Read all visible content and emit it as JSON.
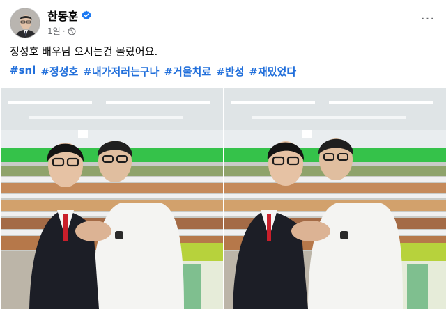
{
  "post": {
    "author": "한동훈",
    "time": "1일",
    "meta_separator": "·",
    "caption": "정성호 배우님 오시는건 몰랐어요.",
    "hashtags": [
      "#snl",
      "#정성호",
      "#내가저러는구나",
      "#거울치료",
      "#반성",
      "#재밌었다"
    ],
    "more_icon_text": "···"
  },
  "icons": {
    "verified": "verified-badge-icon",
    "audience": "globe-icon",
    "more": "more-options-icon"
  },
  "colors": {
    "text_primary": "#050505",
    "text_secondary": "#65676b",
    "hashtag": "#216fdb",
    "verified": "#1877f2"
  }
}
